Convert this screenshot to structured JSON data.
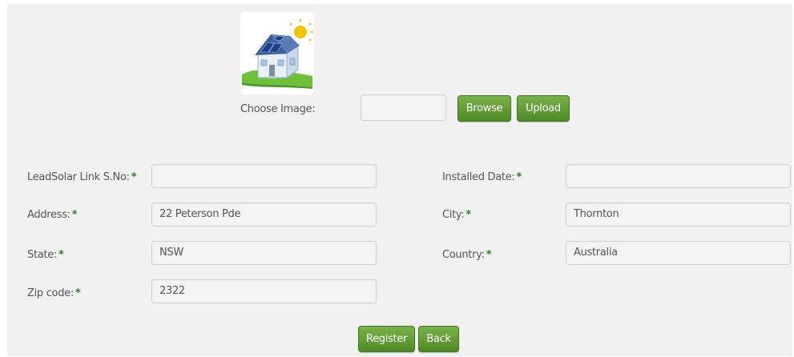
{
  "image_upload": {
    "label": "Choose Image:",
    "file_value": "",
    "browse_label": "Browse",
    "upload_label": "Upload",
    "preview_icon": "solar-house-icon"
  },
  "form": {
    "leadsolar_label": "LeadSolar Link S.No:",
    "leadsolar_value": "",
    "installed_date_label": "Installed Date:",
    "installed_date_value": "",
    "address_label": "Address:",
    "address_value": "22 Peterson Pde",
    "city_label": "City:",
    "city_value": "Thornton",
    "state_label": "State:",
    "state_value": "NSW",
    "country_label": "Country:",
    "country_value": "Australia",
    "zip_label": "Zip code:",
    "zip_value": "2322",
    "required_mark": "*"
  },
  "actions": {
    "register_label": "Register",
    "back_label": "Back"
  },
  "colors": {
    "button_green": "#5f9a32",
    "required_green": "#2f7a2f",
    "panel_bg": "#f1f1f1"
  }
}
